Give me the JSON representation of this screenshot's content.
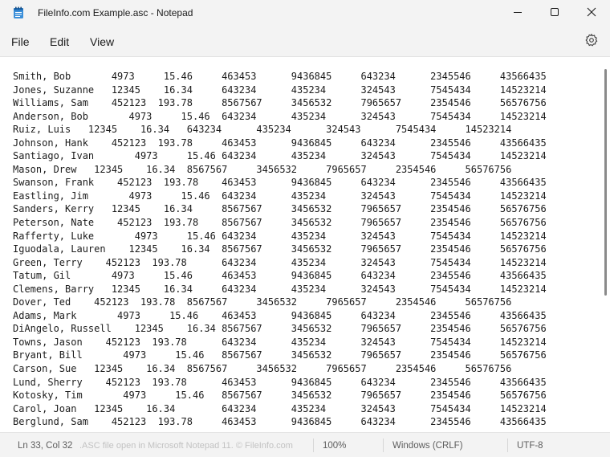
{
  "window": {
    "title": "FileInfo.com Example.asc - Notepad"
  },
  "icons": {
    "app": "notepad-icon",
    "minimize": "minimize-icon",
    "maximize": "maximize-icon",
    "close": "close-icon",
    "settings": "gear-icon"
  },
  "menu": {
    "file": "File",
    "edit": "Edit",
    "view": "View"
  },
  "editor": {
    "lines": [
      "Smith, Bob       4973     15.46     463453      9436845     643234      2345546     43566435",
      "Jones, Suzanne   12345    16.34     643234      435234      324543      7545434     14523214",
      "Williams, Sam    452123  193.78     8567567     3456532     7965657     2354546     56576756",
      "Anderson, Bob       4973     15.46  643234      435234      324543      7545434     14523214",
      "Ruiz, Luis   12345    16.34   643234      435234      324543      7545434     14523214",
      "Johnson, Hank    452123  193.78     463453      9436845     643234      2345546     43566435",
      "Santiago, Ivan       4973     15.46 643234      435234      324543      7545434     14523214",
      "Mason, Drew   12345    16.34  8567567     3456532     7965657     2354546     56576756",
      "Swanson, Frank    452123  193.78    463453      9436845     643234      2345546     43566435",
      "Eastling, Jim       4973     15.46  643234      435234      324543      7545434     14523214",
      "Sanders, Kerry   12345    16.34     8567567     3456532     7965657     2354546     56576756",
      "Peterson, Nate    452123  193.78    8567567     3456532     7965657     2354546     56576756",
      "Rafferty, Luke       4973     15.46 643234      435234      324543      7545434     14523214",
      "Iguodala, Lauren    12345    16.34  8567567     3456532     7965657     2354546     56576756",
      "Green, Terry    452123  193.78      643234      435234      324543      7545434     14523214",
      "Tatum, Gil       4973     15.46     463453      9436845     643234      2345546     43566435",
      "Clemens, Barry   12345    16.34     643234      435234      324543      7545434     14523214",
      "Dover, Ted    452123  193.78  8567567     3456532     7965657     2354546     56576756",
      "Adams, Mark       4973     15.46    463453      9436845     643234      2345546     43566435",
      "DiAngelo, Russell    12345    16.34 8567567     3456532     7965657     2354546     56576756",
      "Towns, Jason    452123  193.78      643234      435234      324543      7545434     14523214",
      "Bryant, Bill       4973     15.46   8567567     3456532     7965657     2354546     56576756",
      "Carson, Sue   12345    16.34  8567567     3456532     7965657     2354546     56576756",
      "Lund, Sherry    452123  193.78      463453      9436845     643234      2345546     43566435",
      "Kotosky, Tim       4973     15.46   8567567     3456532     7965657     2354546     56576756",
      "Carol, Joan   12345    16.34        643234      435234      324543      7545434     14523214",
      "Berglund, Sam    452123  193.78     463453      9436845     643234      2345546     43566435"
    ]
  },
  "status": {
    "position": "Ln 33, Col 32",
    "watermark": ".ASC file open in Microsoft Notepad 11. © FileInfo.com",
    "zoom": "100%",
    "line_ending": "Windows (CRLF)",
    "encoding": "UTF-8"
  }
}
